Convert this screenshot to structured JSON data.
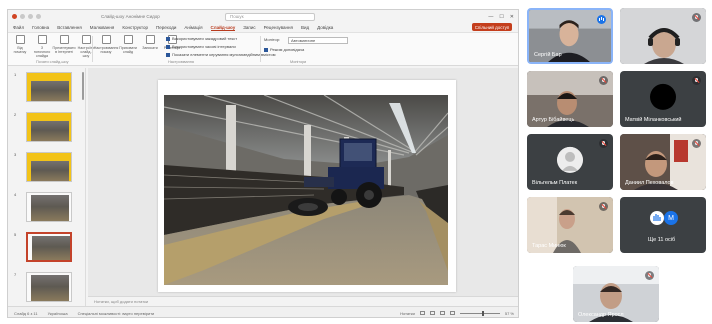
{
  "powerpoint": {
    "window_title": "Слайд-шоу Анонімне Сидор",
    "search_placeholder": "Пошук",
    "menu_tabs": [
      "Файл",
      "Головна",
      "Вставлення",
      "Малювання",
      "Конструктор",
      "Переходи",
      "Анімація",
      "Слайд-шоу",
      "Запис",
      "Рецензування",
      "Вид",
      "Довідка"
    ],
    "active_tab": "Слайд-шоу",
    "share_label": "Спільний доступ",
    "ribbon": {
      "buttons": [
        "Від початку",
        "З поточного слайда",
        "Презентувати в Інтернеті",
        "Настроїти слайд-шоу",
        "Настроювання показу",
        "Приховати слайд",
        "Записати",
        "Репетиція"
      ],
      "checkboxes": [
        "Використовувати закадровий текст",
        "Використовувати часові інтервали",
        "Показати елементи керування мультимедійним вмістом"
      ],
      "monitor_label": "Монітор:",
      "monitor_value": "Автоматичне",
      "presenter_view": "Режим доповідача",
      "groups": [
        "Почати слайд-шоу",
        "Настроювання",
        "Монітори"
      ]
    },
    "slides": [
      {
        "num": "1",
        "style": "yellow"
      },
      {
        "num": "2",
        "style": "yellow"
      },
      {
        "num": "3",
        "style": "yellow"
      },
      {
        "num": "4",
        "style": "white"
      },
      {
        "num": "5",
        "style": "white",
        "selected": true
      },
      {
        "num": "7",
        "style": "white"
      }
    ],
    "notes_placeholder": "Нотатки, щоб додати нотатки",
    "status": {
      "slide_counter": "Слайд 6 з 11",
      "language": "Українська",
      "accessibility": "Спеціальні можливості: варто перевірити",
      "notes": "Нотатки",
      "zoom": "57 %"
    }
  },
  "participants": [
    {
      "name": "Сергій Бар",
      "mic": "speaking",
      "type": "video"
    },
    {
      "name": "",
      "mic": "muted",
      "type": "video"
    },
    {
      "name": "Артур Бібайвець",
      "mic": "muted",
      "type": "video"
    },
    {
      "name": "Матвій Міланковський",
      "mic": "muted",
      "type": "avatar"
    },
    {
      "name": "Вільгельм Платек",
      "mic": "muted",
      "type": "avatar"
    },
    {
      "name": "Даниил Пеховалов",
      "mic": "muted",
      "type": "video"
    },
    {
      "name": "Тарас Минюк",
      "mic": "muted",
      "type": "video"
    },
    {
      "name": "Ще 11 осіб",
      "mic": "",
      "type": "more"
    },
    {
      "name": "Олександр Яросл",
      "mic": "muted",
      "type": "video"
    }
  ],
  "more_initial": "М",
  "colors": {
    "powerpoint_accent": "#c43e1c",
    "call_tile_bg": "#3c4043",
    "active_speaker": "#8ab4f8"
  }
}
